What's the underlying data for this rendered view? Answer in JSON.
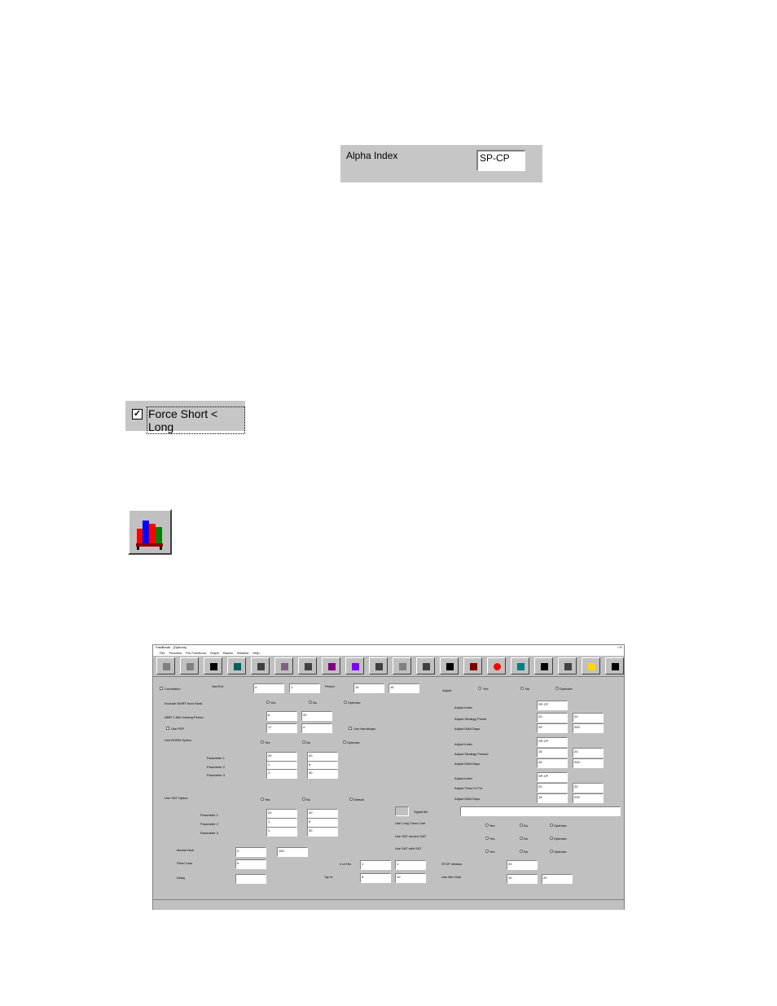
{
  "alpha_panel": {
    "label": "Alpha Index",
    "value": "SP-CP"
  },
  "force_panel": {
    "label": "Force Short < Long",
    "checked": true
  },
  "chart_button": {
    "icon": "bar-chart-icon",
    "colors": [
      "#ff0000",
      "#0000ff",
      "#008000",
      "#8b0000"
    ]
  },
  "window": {
    "title": "FastBreak - [Options]",
    "menu": [
      "File",
      "Function",
      "Pro Functions",
      "Graph",
      "Basics",
      "Window",
      "Help"
    ],
    "toolbar_icons": [
      "arrow-icon",
      "open-icon",
      "save-icon",
      "book-icon",
      "cube-icon",
      "document-icon",
      "grid-icon",
      "calendar-icon",
      "chart-icon",
      "color-wheel-icon",
      "diamond-icon",
      "refresh-icon",
      "scissors-icon",
      "mountain-icon",
      "stop-icon",
      "pin-icon",
      "people-icon",
      "table-icon",
      "bulb-icon",
      "exit-icon"
    ],
    "left": {
      "correlation": "Correlation",
      "vari_ent": "Vari Ent",
      "vari_values": [
        "4",
        "1"
      ],
      "period": "Period",
      "period_values": [
        "10",
        "15"
      ],
      "exclude_label": "Exclude NMRT from Rank",
      "yes": "Yes",
      "no": "No",
      "optimize": "Optimize",
      "nmr_label": "NMR T-Min Holding Period",
      "nmr_values": [
        "6",
        "20"
      ],
      "use_pep": "Use PEP",
      "pep_values": [
        "17",
        "4"
      ],
      "use_handicap": "Use Handicaps",
      "use_boem": "Use BOEM Option",
      "params": [
        "Parameter 1",
        "Parameter 2",
        "Parameter 3"
      ],
      "boem_values": [
        [
          "20",
          "40"
        ],
        [
          "1",
          "8"
        ],
        [
          "1",
          "30"
        ]
      ],
      "use_sat": "Use SAT Option",
      "sat_values": [
        [
          "20",
          "40"
        ],
        [
          "1",
          "8"
        ],
        [
          "1",
          "30"
        ]
      ],
      "default": "Default",
      "market_nick": "Market Nick",
      "market_values": [
        "4",
        "100"
      ],
      "short_loss": "Short Loss",
      "short_value": "5",
      "delay": "Delay",
      "delay_value": "",
      "rank_hr": "# of Hrs",
      "rank_values": [
        "1",
        "1"
      ],
      "top_n": "Top N",
      "top_values": [
        "5",
        "10"
      ]
    },
    "right": {
      "adjust": "Adjust",
      "adjust_index": "Adjust Index",
      "adjust_strategy": "Adjust Strategy Points",
      "adjust_dma": "Adjust DMA Days",
      "block1": [
        "SP-CP",
        "20",
        "20",
        "25",
        "200"
      ],
      "adjust_strategy2": "Adjust Strategy Points2",
      "block2": [
        "SP-CP",
        "15",
        "20",
        "25",
        "200"
      ],
      "adjust_trend": "Adjust Trend % Pct",
      "block3": [
        "SP-CP",
        "20",
        "20",
        "15",
        "200"
      ],
      "signal_file": "Signal file",
      "use_long_trend": "Use Long Trend Line",
      "use_sat_second": "Use SAT second SAT",
      "use_sat_with": "Use SAT with SAT",
      "stop_window": "STOP window",
      "stop_value": "20",
      "use_min_hold": "Use Min Hold",
      "min_values": [
        "10",
        "20"
      ]
    }
  }
}
